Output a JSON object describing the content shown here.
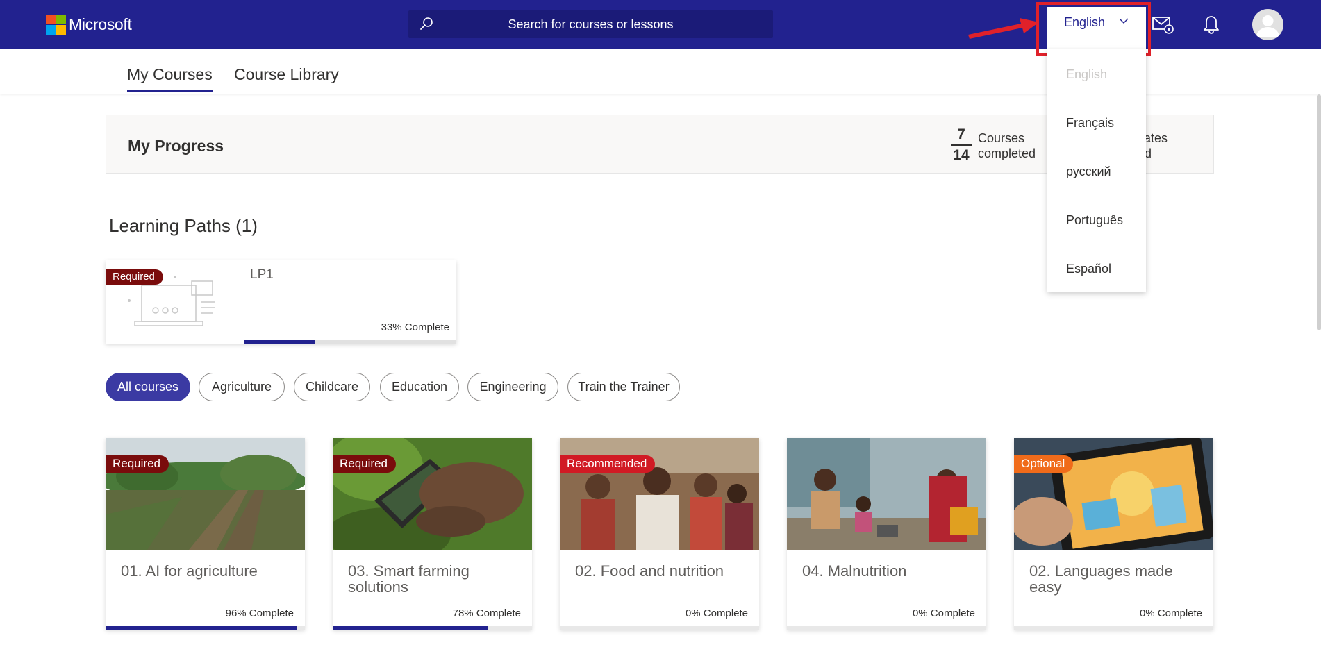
{
  "header": {
    "brand": "Microsoft",
    "logo_colors": [
      "#f25022",
      "#7fba00",
      "#00a4ef",
      "#ffb900"
    ],
    "search_placeholder": "Search for courses or lessons",
    "language_selected": "English",
    "icons": [
      "search-icon",
      "chevron-down-icon",
      "mail-settings-icon",
      "bell-icon",
      "user-avatar-icon"
    ]
  },
  "tabs": [
    {
      "label": "My Courses",
      "active": true
    },
    {
      "label": "Course Library",
      "active": false
    }
  ],
  "progress": {
    "title": "My Progress",
    "courses_completed": "7",
    "courses_total": "14",
    "courses_label_1": "Courses",
    "courses_label_2": "completed",
    "cert_label_1": "cates",
    "cert_label_2": "ed"
  },
  "learning_paths": {
    "title": "Learning Paths (1)",
    "items": [
      {
        "badge": "Required",
        "title": "LP1",
        "complete_text": "33% Complete",
        "progress": 0.33
      }
    ]
  },
  "filters": [
    "All courses",
    "Agriculture",
    "Childcare",
    "Education",
    "Engineering",
    "Train the Trainer"
  ],
  "courses": [
    {
      "badge": "Required",
      "badge_type": "req",
      "title": "01. AI for agriculture",
      "complete_text": "96% Complete",
      "progress": 0.96
    },
    {
      "badge": "Required",
      "badge_type": "req",
      "title": "03. Smart farming solutions",
      "complete_text": "78% Complete",
      "progress": 0.78
    },
    {
      "badge": "Recommended",
      "badge_type": "rec",
      "title": "02. Food and nutrition",
      "complete_text": "0% Complete",
      "progress": 0
    },
    {
      "badge": "",
      "badge_type": "",
      "title": "04. Malnutrition",
      "complete_text": "0% Complete",
      "progress": 0
    },
    {
      "badge": "Optional",
      "badge_type": "opt",
      "title": "02. Languages made easy",
      "complete_text": "0% Complete",
      "progress": 0
    }
  ],
  "language_menu": {
    "options": [
      "English",
      "Français",
      "русский",
      "Português",
      "Español"
    ],
    "disabled_index": 0
  },
  "colors": {
    "header_bg": "#22228f",
    "accent": "#22228f",
    "highlight_box": "#e0212a",
    "badge_required": "#7a0c0c",
    "badge_recommended": "#d11a24",
    "badge_optional": "#f06b1a"
  }
}
